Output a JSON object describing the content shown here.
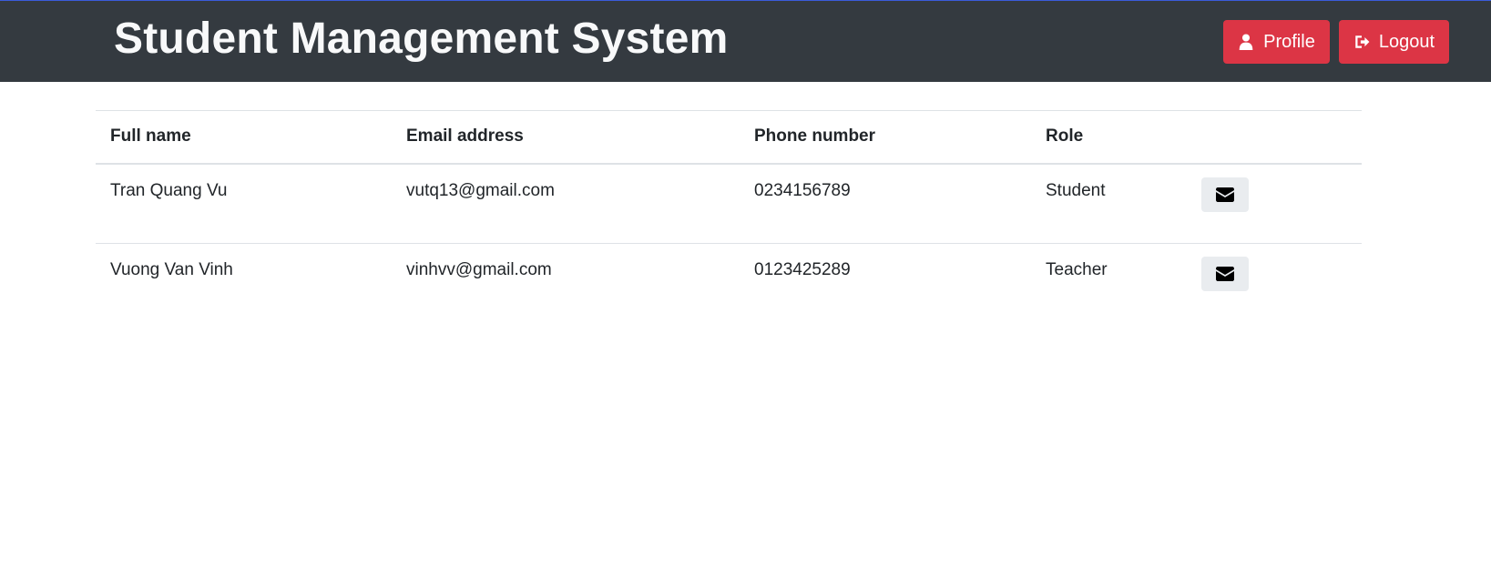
{
  "header": {
    "title": "Student Management System",
    "profile_label": "Profile",
    "logout_label": "Logout",
    "profile_icon": "user-icon",
    "logout_icon": "sign-out-icon",
    "button_color": "#dc3545",
    "bar_color": "#343a40"
  },
  "table": {
    "columns": [
      "Full name",
      "Email address",
      "Phone number",
      "Role",
      ""
    ],
    "rows": [
      {
        "name": "Tran Quang Vu",
        "email": "vutq13@gmail.com",
        "phone": "0234156789",
        "role": "Student",
        "action_icon": "envelope-icon"
      },
      {
        "name": "Vuong Van Vinh",
        "email": "vinhvv@gmail.com",
        "phone": "0123425289",
        "role": "Teacher",
        "action_icon": "envelope-icon"
      }
    ]
  }
}
